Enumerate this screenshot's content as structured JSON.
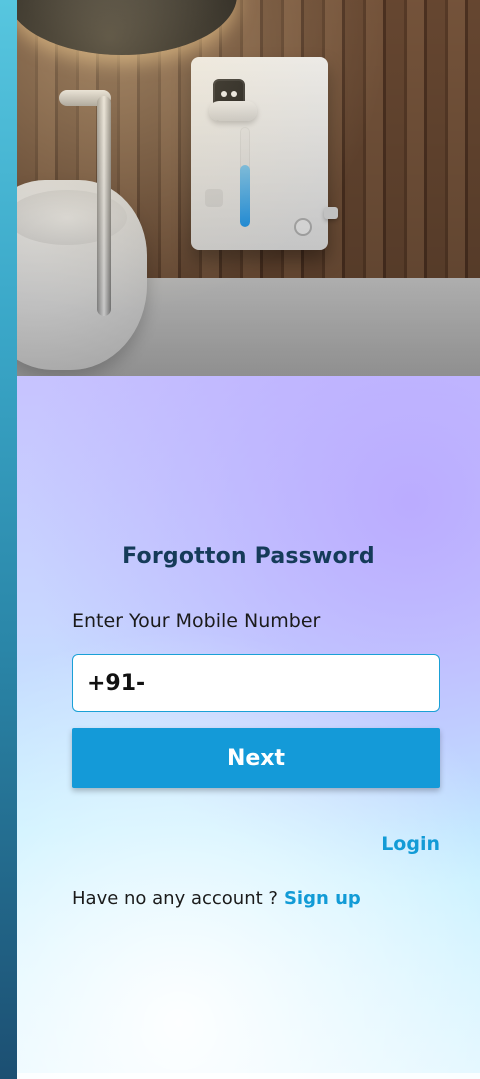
{
  "hero": {
    "icons": [
      "dispenser-icon",
      "faucet-icon",
      "basin-icon",
      "mirror-icon"
    ],
    "dispenser": {
      "level_fraction": 0.62,
      "accent_color": "#1aa0ff"
    }
  },
  "forgot_password": {
    "title": "Forgotton Password",
    "mobile_label": "Enter Your Mobile Number",
    "mobile_value": "+91-",
    "next_button_label": "Next",
    "login_link_label": "Login",
    "no_account_text": "Have no any account ?",
    "signup_link_label": "Sign up"
  },
  "colors": {
    "title_color": "#153b59",
    "primary_button": "#149ad8",
    "link_color": "#129bd6"
  }
}
